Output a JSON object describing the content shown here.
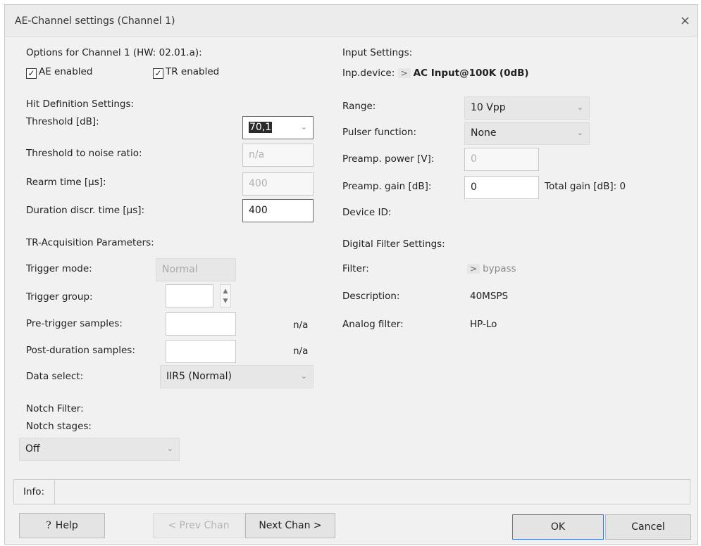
{
  "window": {
    "title": "AE-Channel settings (Channel 1)",
    "close_glyph": "×"
  },
  "options": {
    "heading": "Options for Channel 1 (HW: 02.01.a):",
    "ae_label": "AE enabled",
    "ae_checked": true,
    "tr_label": "TR enabled",
    "tr_checked": true
  },
  "hit_definition": {
    "heading": "Hit Definition Settings:",
    "threshold_label": "Threshold [dB]:",
    "threshold_value": "70,1",
    "noise_ratio_label": "Threshold to noise ratio:",
    "noise_ratio_value": "n/a",
    "rearm_label": "Rearm time [µs]:",
    "rearm_value": "400",
    "duration_label": "Duration discr. time [µs]:",
    "duration_value": "400"
  },
  "tr_acquisition": {
    "heading": "TR-Acquisition Parameters:",
    "trigger_mode_label": "Trigger mode:",
    "trigger_mode_value": "Normal",
    "trigger_group_label": "Trigger group:",
    "trigger_group_value": "",
    "pretrigger_label": "Pre-trigger samples:",
    "pretrigger_value": "",
    "pretrigger_unit": "n/a",
    "postduration_label": "Post-duration samples:",
    "postduration_value": "",
    "postduration_unit": "n/a",
    "data_select_label": "Data select:",
    "data_select_value": "IIR5 (Normal)"
  },
  "notch": {
    "heading": "Notch Filter:",
    "stages_label": "Notch stages:",
    "stages_value": "Off"
  },
  "input_settings": {
    "heading": "Input Settings:",
    "device_label": "Inp.device:",
    "device_arrow": ">",
    "device_value": "AC Input@100K (0dB)",
    "range_label": "Range:",
    "range_value": "10 Vpp",
    "pulser_label": "Pulser function:",
    "pulser_value": "None",
    "preamp_power_label": "Preamp. power [V]:",
    "preamp_power_value": "0",
    "preamp_gain_label": "Preamp. gain [dB]:",
    "preamp_gain_value": "0",
    "total_gain_label": "Total gain [dB]: 0",
    "device_id_label": "Device ID:"
  },
  "digital_filter": {
    "heading": "Digital Filter Settings:",
    "filter_label": "Filter:",
    "filter_arrow": ">",
    "filter_value": "bypass",
    "description_label": "Description:",
    "description_value": "40MSPS",
    "analog_label": "Analog filter:",
    "analog_value": "HP-Lo"
  },
  "info": {
    "label": "Info:",
    "value": ""
  },
  "buttons": {
    "help": "Help",
    "help_icon": "?",
    "prev": "< Prev Chan",
    "next": "Next Chan >",
    "ok": "OK",
    "cancel": "Cancel"
  },
  "icons": {
    "check": "✓",
    "dropdown": "⌄",
    "spin_up": "▲",
    "spin_down": "▼"
  }
}
